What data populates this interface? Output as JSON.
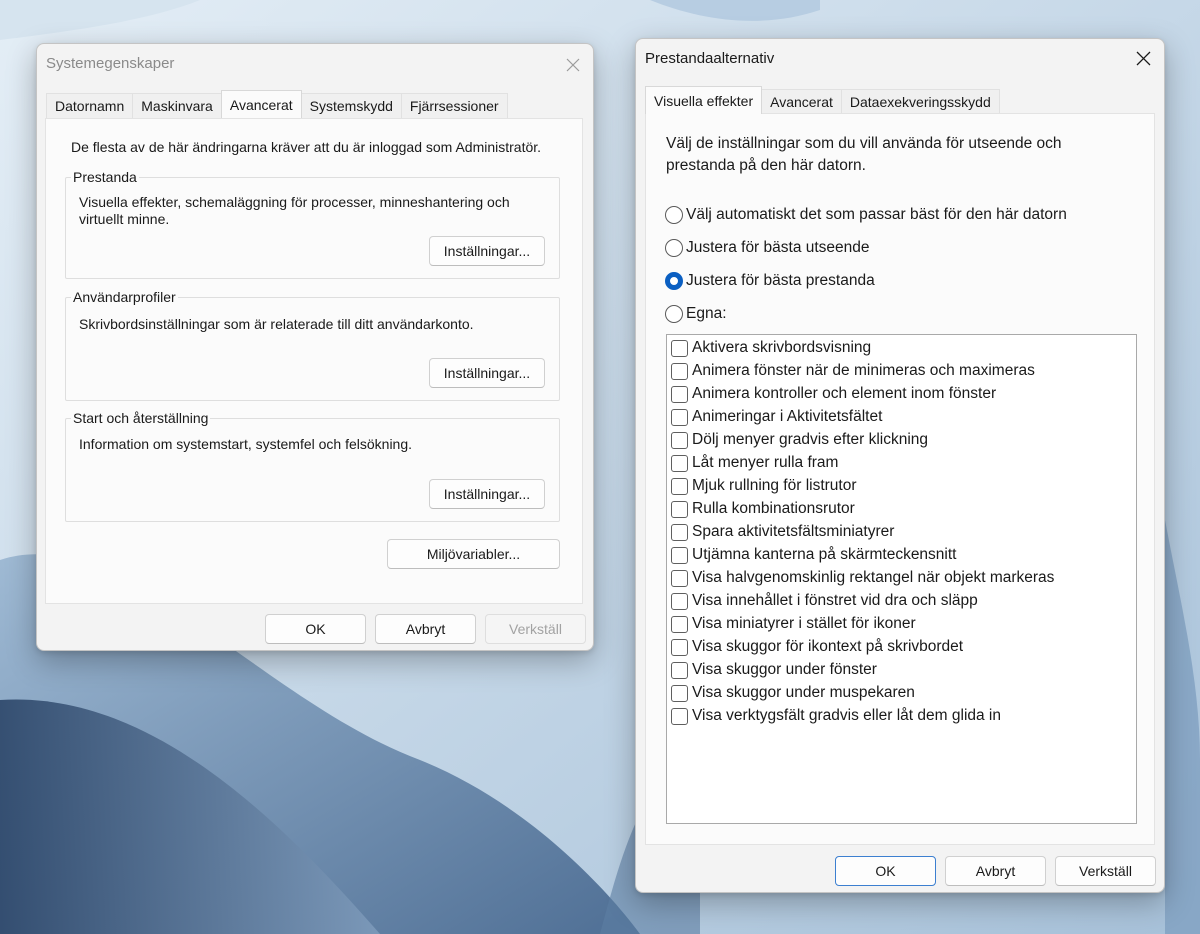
{
  "desktop": {
    "accent": "#0a5fc2"
  },
  "system_properties": {
    "title": "Systemegenskaper",
    "tabs": [
      "Datornamn",
      "Maskinvara",
      "Avancerat",
      "Systemskydd",
      "Fjärrsessioner"
    ],
    "active_tab": "Avancerat",
    "admin_note": "De flesta av de här ändringarna kräver att du är inloggad som Administratör.",
    "groups": [
      {
        "title": "Prestanda",
        "description": "Visuella effekter, schemaläggning för processer, minneshantering och virtuellt minne.",
        "button": "Inställningar..."
      },
      {
        "title": "Användarprofiler",
        "description": "Skrivbordsinställningar som är relaterade till ditt användarkonto.",
        "button": "Inställningar..."
      },
      {
        "title": "Start och återställning",
        "description": "Information om systemstart, systemfel och felsökning.",
        "button": "Inställningar..."
      }
    ],
    "env_button": "Miljövariabler...",
    "ok": "OK",
    "cancel": "Avbryt",
    "apply": "Verkställ"
  },
  "performance_options": {
    "title": "Prestandaalternativ",
    "tabs": [
      "Visuella effekter",
      "Avancerat",
      "Dataexekveringsskydd"
    ],
    "active_tab": "Visuella effekter",
    "intro": [
      "Välj de inställningar som du vill använda för utseende och",
      "prestanda på den här datorn."
    ],
    "radios": [
      {
        "label": "Välj automatiskt det som passar bäst för den här datorn",
        "checked": false
      },
      {
        "label": "Justera för bästa utseende",
        "checked": false
      },
      {
        "label": "Justera för bästa prestanda",
        "checked": true
      },
      {
        "label": "Egna:",
        "checked": false
      }
    ],
    "effects": [
      "Aktivera skrivbordsvisning",
      "Animera fönster när de minimeras och maximeras",
      "Animera kontroller och element inom fönster",
      "Animeringar i Aktivitetsfältet",
      "Dölj menyer gradvis efter klickning",
      "Låt menyer rulla fram",
      "Mjuk rullning för listrutor",
      "Rulla kombinationsrutor",
      "Spara aktivitetsfältsminiatyrer",
      "Utjämna kanterna på skärmteckensnitt",
      "Visa halvgenomskinlig rektangel när objekt markeras",
      "Visa innehållet i fönstret vid dra och släpp",
      "Visa miniatyrer i stället för ikoner",
      "Visa skuggor för ikontext på skrivbordet",
      "Visa skuggor under fönster",
      "Visa skuggor under muspekaren",
      "Visa verktygsfält gradvis eller låt dem glida in"
    ],
    "ok": "OK",
    "cancel": "Avbryt",
    "apply": "Verkställ"
  }
}
